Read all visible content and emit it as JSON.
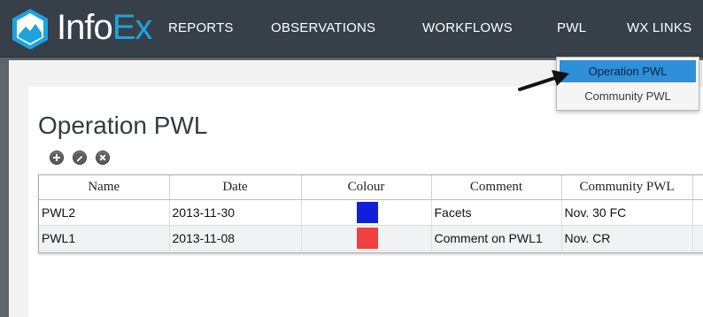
{
  "app": {
    "brand_prefix": "Info",
    "brand_suffix": "Ex"
  },
  "nav": {
    "items": [
      {
        "label": "REPORTS"
      },
      {
        "label": "OBSERVATIONS"
      },
      {
        "label": "WORKFLOWS"
      },
      {
        "label": "PWL"
      },
      {
        "label": "WX LINKS"
      }
    ]
  },
  "pwl_menu": {
    "items": [
      {
        "label": "Operation PWL",
        "selected": true
      },
      {
        "label": "Community PWL",
        "selected": false
      }
    ]
  },
  "page": {
    "title": "Operation PWL",
    "toolbar_icons": [
      "add-icon",
      "edit-icon",
      "delete-icon"
    ]
  },
  "table": {
    "headers": [
      "Name",
      "Date",
      "Colour",
      "Comment",
      "Community PWL"
    ],
    "rows": [
      {
        "name": "PWL2",
        "date": "2013-11-30",
        "colour": "#1020d8",
        "comment": "Facets",
        "community_pwl": "Nov. 30 FC"
      },
      {
        "name": "PWL1",
        "date": "2013-11-08",
        "colour": "#f04040",
        "comment": "Comment on PWL1",
        "community_pwl": "Nov. CR"
      }
    ]
  },
  "colors": {
    "topbar": "#374049",
    "brand_accent": "#1ea3df",
    "menu_highlight": "#2f8fd8"
  }
}
